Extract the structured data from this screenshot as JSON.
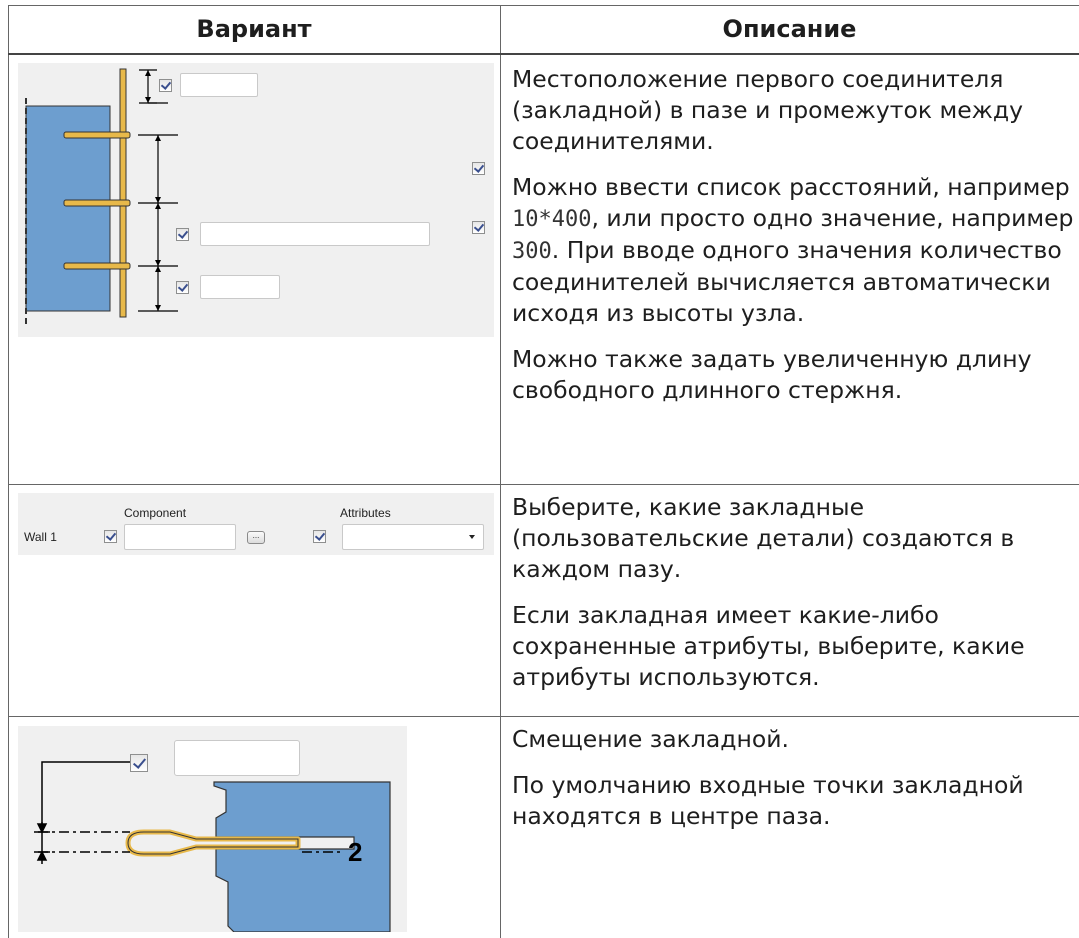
{
  "table": {
    "headers": {
      "variant": "Вариант",
      "description": "Описание"
    }
  },
  "rows": [
    {
      "paragraphs": [
        "Местоположение первого соединителя (закладной) в пазе и промежуток между соединителями.",
        "Можно ввести список расстояний, например 10*400, или просто одно значение, например 300. При вводе одного значения количество соединителей вычисляется автоматически исходя из высоты узла.",
        "Можно также задать увеличенную длину свободного длинного стержня."
      ],
      "p2_parts": {
        "a": "Можно ввести список расстояний, например ",
        "code1": "10*400",
        "b": ", или просто одно значение, например ",
        "code2": "300",
        "c": ". При вводе одного значения количество соединителей вычисляется автоматически исходя из высоты узла."
      }
    },
    {
      "panel": {
        "component_label": "Component",
        "attributes_label": "Attributes",
        "wall_label": "Wall 1",
        "browse_label": "...",
        "dropdown_icon": "chevron-down-icon"
      },
      "paragraphs": [
        "Выберите, какие закладные (пользовательские детали) создаются в каждом пазу.",
        "Если закладная имеет какие-либо сохраненные атрибуты, выберите, какие атрибуты используются."
      ]
    },
    {
      "panel": {
        "dimension_label": "2"
      },
      "paragraphs": [
        "Смещение закладной.",
        "По умолчанию входные точки закладной находятся в центре паза."
      ]
    }
  ],
  "colors": {
    "accent_blue": "#6d9ecf",
    "panel_bg": "#f0f0f0",
    "insert_gold": "#e8b94a"
  }
}
